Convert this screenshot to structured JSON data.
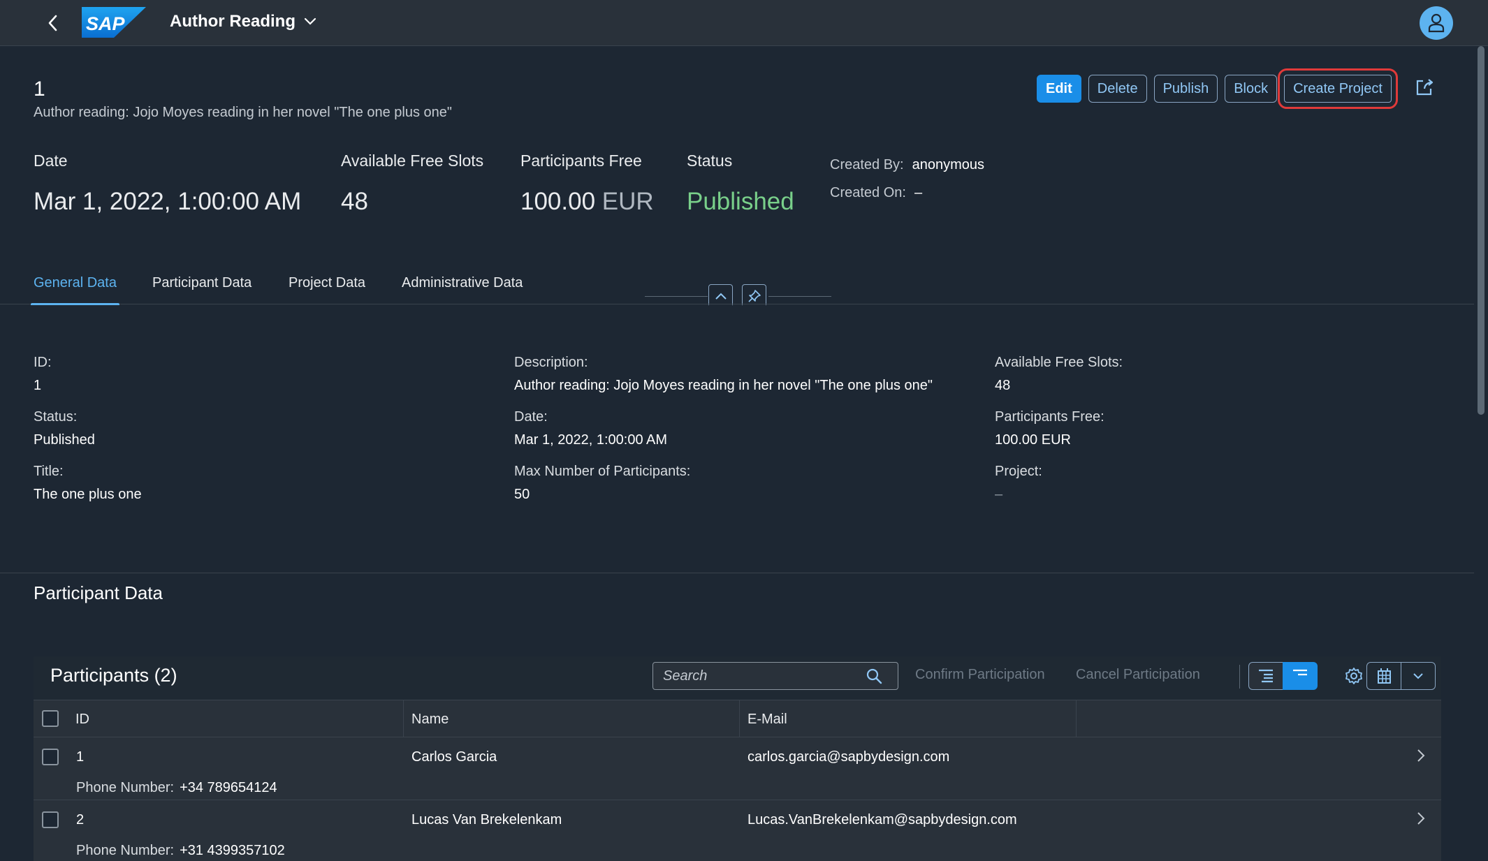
{
  "shell": {
    "logo_text": "SAP",
    "app_title": "Author Reading"
  },
  "header": {
    "title": "1",
    "subtitle": "Author reading: Jojo Moyes reading in her novel \"The one plus one\"",
    "actions": {
      "edit": "Edit",
      "delete": "Delete",
      "publish": "Publish",
      "block": "Block",
      "create_project": "Create Project"
    },
    "kpis": {
      "date_label": "Date",
      "date_value": "Mar 1, 2022, 1:00:00 AM",
      "slots_label": "Available Free Slots",
      "slots_value": "48",
      "fee_label": "Participants Free",
      "fee_value": "100.00",
      "fee_unit": "EUR",
      "status_label": "Status",
      "status_value": "Published"
    },
    "meta": {
      "created_by_label": "Created By:",
      "created_by_value": "anonymous",
      "created_on_label": "Created On:",
      "created_on_value": "–"
    }
  },
  "tabs": [
    "General Data",
    "Participant Data",
    "Project Data",
    "Administrative Data"
  ],
  "general": {
    "id_label": "ID:",
    "id_value": "1",
    "status_label": "Status:",
    "status_value": "Published",
    "title_label": "Title:",
    "title_value": "The one plus one",
    "description_label": "Description:",
    "description_value": "Author reading: Jojo Moyes reading in her novel \"The one plus one\"",
    "date_label": "Date:",
    "date_value": "Mar 1, 2022, 1:00:00 AM",
    "max_label": "Max Number of Participants:",
    "max_value": "50",
    "slots_label": "Available Free Slots:",
    "slots_value": "48",
    "fee_label": "Participants Free:",
    "fee_value": "100.00 EUR",
    "project_label": "Project:",
    "project_value": "–"
  },
  "participant_section": {
    "title": "Participant Data",
    "table_title": "Participants (2)",
    "search_placeholder": "Search",
    "confirm_label": "Confirm Participation",
    "cancel_label": "Cancel Participation",
    "columns": [
      "ID",
      "Name",
      "E-Mail"
    ],
    "phone_label": "Phone Number:",
    "rows": [
      {
        "id": "1",
        "name": "Carlos Garcia",
        "email": "carlos.garcia@sapbydesign.com",
        "phone": "+34 789654124"
      },
      {
        "id": "2",
        "name": "Lucas Van Brekelenkam",
        "email": "Lucas.VanBrekelenkam@sapbydesign.com",
        "phone": "+31 4399357102"
      }
    ]
  },
  "colors": {
    "shell_bg": "#29313a",
    "page_bg": "#1d2733",
    "accent": "#1a8ee8",
    "link": "#91c8f6",
    "status_positive": "#79d08a",
    "focus_outline": "#e03a3a"
  }
}
